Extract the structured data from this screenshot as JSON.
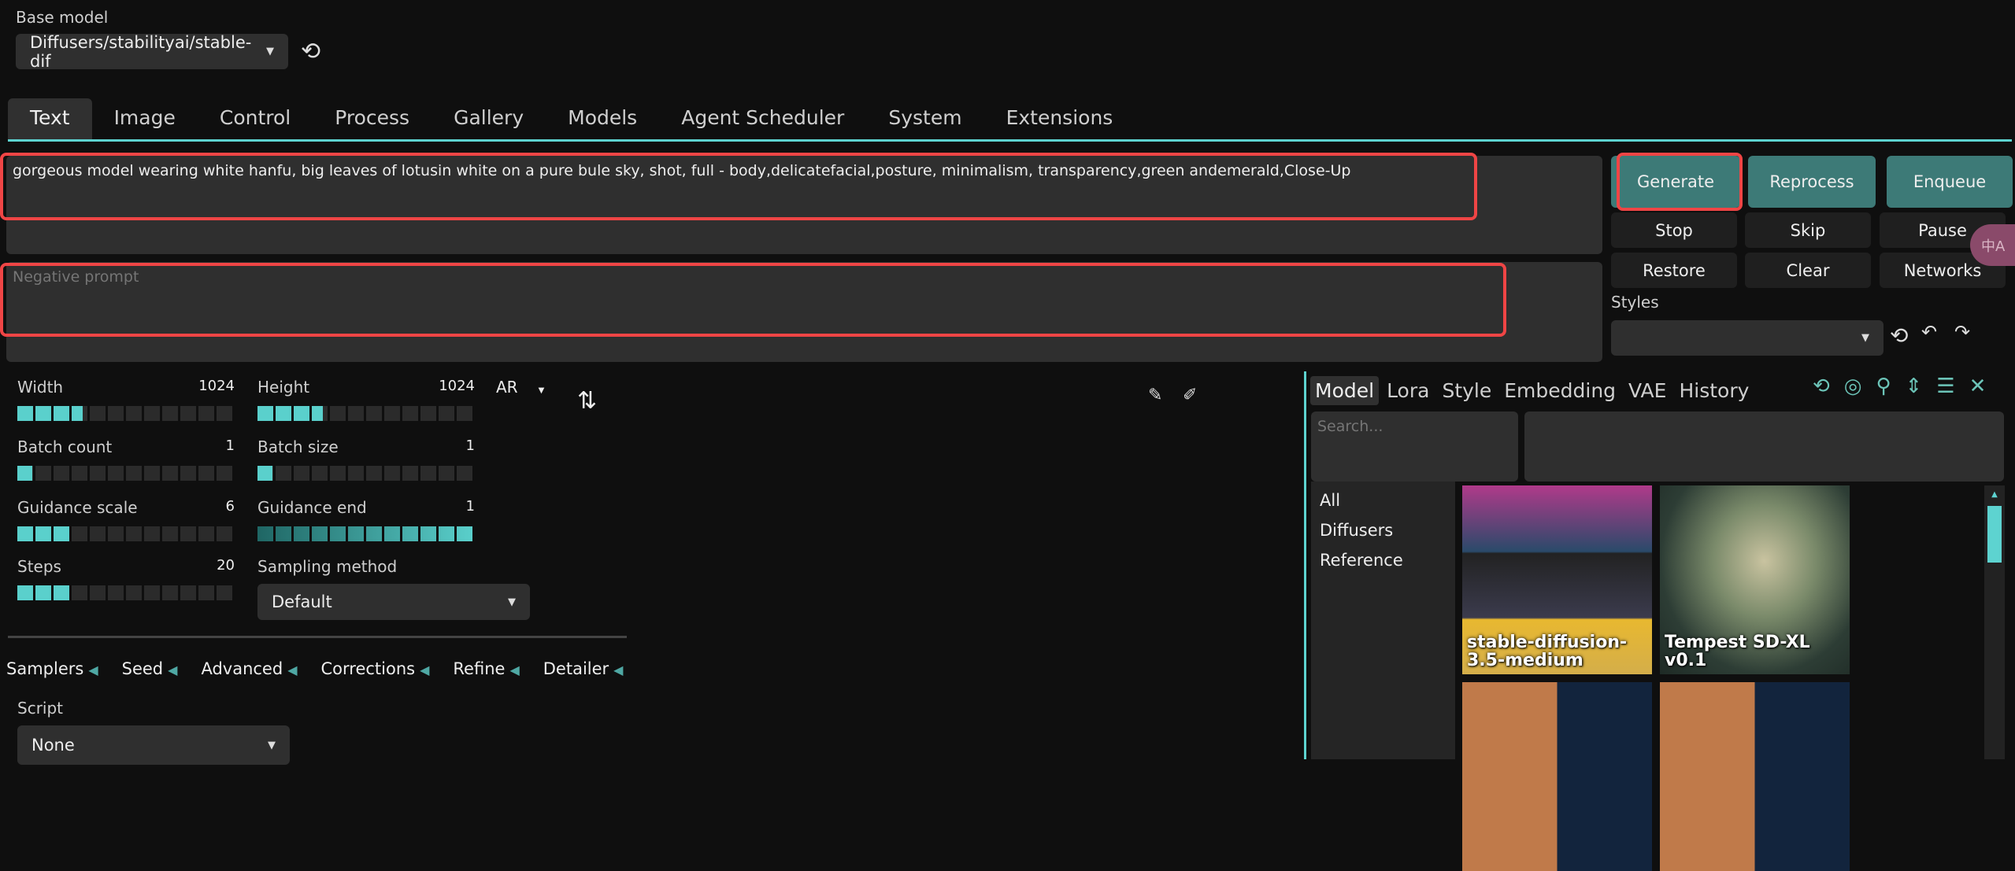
{
  "header": {
    "base_model_label": "Base model",
    "base_model_value": "Diffusers/stabilityai/stable-dif"
  },
  "tabs": [
    {
      "label": "Text"
    },
    {
      "label": "Image"
    },
    {
      "label": "Control"
    },
    {
      "label": "Process"
    },
    {
      "label": "Gallery"
    },
    {
      "label": "Models"
    },
    {
      "label": "Agent Scheduler"
    },
    {
      "label": "System"
    },
    {
      "label": "Extensions"
    }
  ],
  "prompt": {
    "value": "gorgeous model wearing white hanfu, big leaves of lotusin white on a pure bule sky, shot, full - body,delicatefacial,posture, minimalism, transparency,green andemerald,Close-Up",
    "negative_placeholder": "Negative prompt"
  },
  "actions": {
    "generate": "Generate",
    "reprocess": "Reprocess",
    "enqueue": "Enqueue",
    "stop": "Stop",
    "skip": "Skip",
    "pause": "Pause",
    "restore": "Restore",
    "clear": "Clear",
    "networks": "Networks",
    "styles_label": "Styles",
    "translate_badge": "中A"
  },
  "sliders": [
    {
      "label": "Width",
      "value": "1024",
      "fill": 0.3
    },
    {
      "label": "Height",
      "value": "1024",
      "fill": 0.3
    },
    {
      "label": "Batch count",
      "value": "1",
      "fill": 0.07
    },
    {
      "label": "Batch size",
      "value": "1",
      "fill": 0.07
    },
    {
      "label": "Guidance scale",
      "value": "6",
      "fill": 0.25
    },
    {
      "label": "Guidance end",
      "value": "1",
      "fill": 1.0
    },
    {
      "label": "Steps",
      "value": "20",
      "fill": 0.25
    }
  ],
  "ar_label": "AR",
  "sampling": {
    "label": "Sampling method",
    "value": "Default"
  },
  "accordions": [
    {
      "label": "Samplers"
    },
    {
      "label": "Seed"
    },
    {
      "label": "Advanced"
    },
    {
      "label": "Corrections"
    },
    {
      "label": "Refine"
    },
    {
      "label": "Detailer"
    }
  ],
  "script": {
    "label": "Script",
    "value": "None"
  },
  "networks": {
    "tabs": [
      {
        "label": "Model"
      },
      {
        "label": "Lora"
      },
      {
        "label": "Style"
      },
      {
        "label": "Embedding"
      },
      {
        "label": "VAE"
      },
      {
        "label": "History"
      }
    ],
    "search_placeholder": "Search...",
    "categories": [
      {
        "label": "All"
      },
      {
        "label": "Diffusers"
      },
      {
        "label": "Reference"
      }
    ],
    "cards": [
      {
        "title": "stable-diffusion-3.5-medium"
      },
      {
        "title": "Tempest SD-XL v0.1"
      },
      {
        "title": ""
      },
      {
        "title": ""
      }
    ]
  },
  "colors": {
    "accent": "#5dd3d0",
    "primary_button": "#3d7a77",
    "highlight": "#ef4545"
  }
}
